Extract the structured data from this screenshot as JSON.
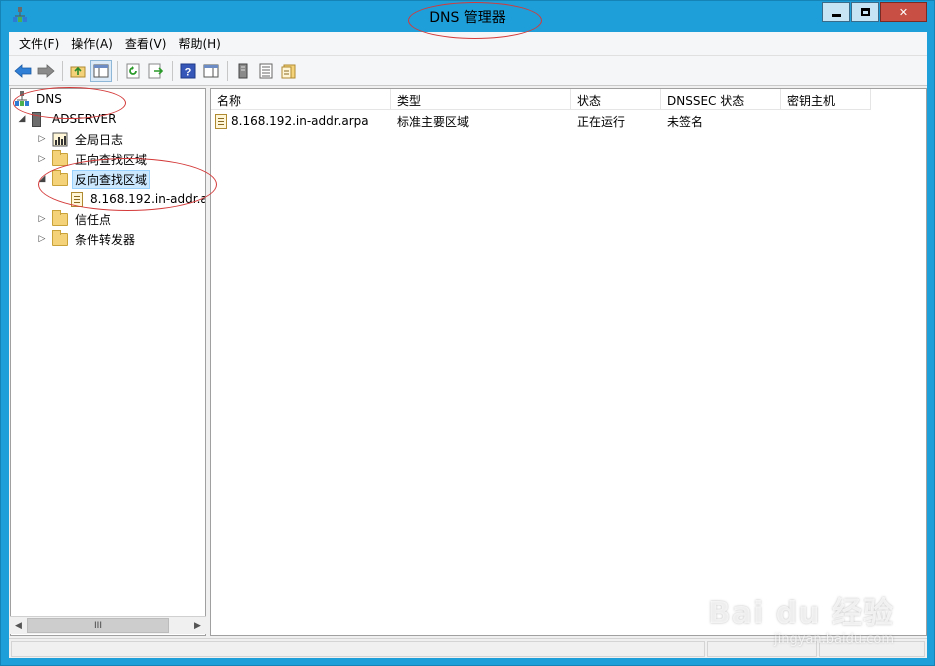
{
  "window": {
    "title": "DNS 管理器"
  },
  "menu": [
    {
      "label": "文件(F)"
    },
    {
      "label": "操作(A)"
    },
    {
      "label": "查看(V)"
    },
    {
      "label": "帮助(H)"
    }
  ],
  "toolbar": {
    "buttons": [
      "back-arrow",
      "forward-arrow",
      "up-folder",
      "show-hide-console-tree",
      "refresh",
      "export-list",
      "help",
      "action-pane",
      "server",
      "list",
      "properties"
    ]
  },
  "tree": {
    "root": "DNS",
    "server": "ADSERVER",
    "items": [
      {
        "label": "全局日志"
      },
      {
        "label": "正向查找区域"
      },
      {
        "label": "反向查找区域"
      },
      {
        "label": "8.168.192.in-addr.a"
      },
      {
        "label": "信任点"
      },
      {
        "label": "条件转发器"
      }
    ],
    "scroll_thumb_label": "III"
  },
  "list": {
    "columns": [
      "名称",
      "类型",
      "状态",
      "DNSSEC 状态",
      "密钥主机"
    ],
    "rows": [
      {
        "name": "8.168.192.in-addr.arpa",
        "type": "标准主要区域",
        "status": "正在运行",
        "dnssec": "未签名",
        "key_master": ""
      }
    ]
  },
  "watermark": {
    "logo": "Bai du 经验",
    "url": "jingyan.baidu.com"
  },
  "colors": {
    "frame": "#1e9fd9",
    "annotation": "#d43a3a",
    "selection": "#cce8ff"
  }
}
